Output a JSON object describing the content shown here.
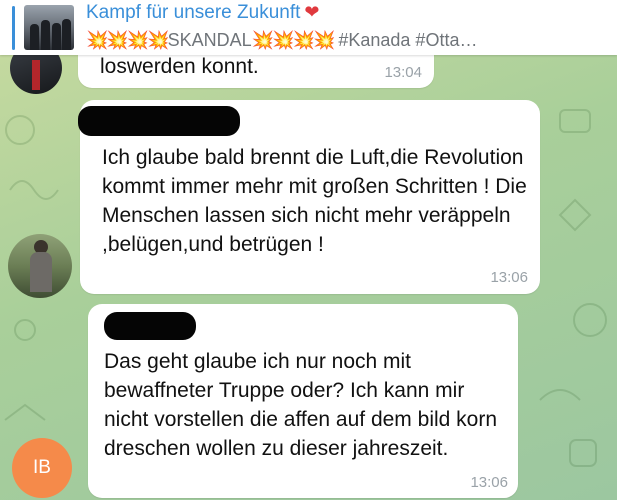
{
  "pinned": {
    "title": "Kampf für unsere Zukunft",
    "heart": "❤",
    "boom_left": "💥💥💥💥",
    "keyword": "SKANDAL",
    "boom_right": "💥💥💥💥",
    "hashtags": " #Kanada #Otta…"
  },
  "messages": [
    {
      "text": "loswerden konnt.",
      "time": "13:04"
    },
    {
      "text": "Ich glaube bald brennt die Luft,die Revolution kommt immer mehr mit großen Schritten ! Die Menschen lassen sich nicht mehr veräppeln ,belügen,und betrügen !",
      "time": "13:06"
    },
    {
      "text": "Das geht glaube ich nur noch mit bewaffneter Truppe oder? Ich kann mir nicht vorstellen die affen auf dem bild korn dreschen wollen zu dieser jahreszeit.",
      "time": "13:06"
    }
  ],
  "avatars": {
    "initials": "IB",
    "initials_color": "#f58a4a"
  },
  "colors": {
    "accent": "#3a8fd9",
    "heart": "#e0393e"
  }
}
